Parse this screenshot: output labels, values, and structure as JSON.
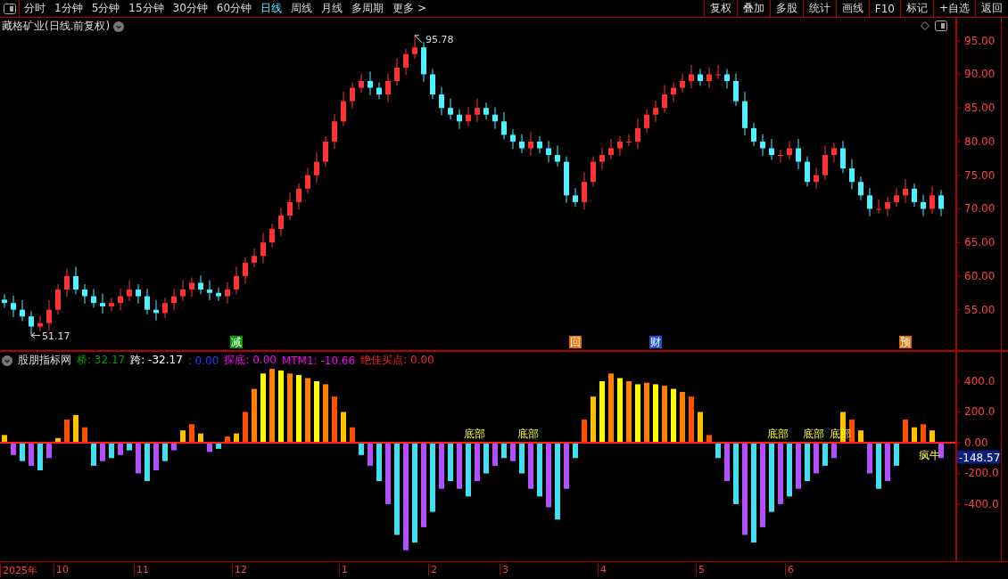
{
  "toolbar": {
    "periods": [
      {
        "label": "分时",
        "selected": false
      },
      {
        "label": "1分钟",
        "selected": false
      },
      {
        "label": "5分钟",
        "selected": false
      },
      {
        "label": "15分钟",
        "selected": false
      },
      {
        "label": "30分钟",
        "selected": false
      },
      {
        "label": "60分钟",
        "selected": false
      },
      {
        "label": "日线",
        "selected": true
      },
      {
        "label": "周线",
        "selected": false
      },
      {
        "label": "月线",
        "selected": false
      },
      {
        "label": "多周期",
        "selected": false
      },
      {
        "label": "更多 >",
        "selected": false
      }
    ],
    "buttons": [
      "复权",
      "叠加",
      "多股",
      "统计",
      "画线",
      "F10",
      "标记",
      "+自选",
      "返回"
    ]
  },
  "price_panel": {
    "title": "藏格矿业(日线.前复权)",
    "chart_data": {
      "type": "candlestick",
      "ylim": [
        49,
        98.4
      ],
      "yticks": [
        {
          "value": 95,
          "label": "95.00"
        },
        {
          "value": 90,
          "label": "90.00"
        },
        {
          "value": 85,
          "label": "85.00"
        },
        {
          "value": 80,
          "label": "80.00"
        },
        {
          "value": 75,
          "label": "75.00"
        },
        {
          "value": 70,
          "label": "70.00"
        },
        {
          "value": 65,
          "label": "65.00"
        },
        {
          "value": 60,
          "label": "60.00"
        },
        {
          "value": 55,
          "label": "55.00"
        }
      ],
      "categories": [
        null,
        null,
        null,
        null,
        null,
        null,
        null,
        null,
        null,
        null,
        null,
        null,
        null,
        null,
        null,
        null,
        null,
        null,
        null,
        null,
        null,
        null,
        null,
        null,
        null,
        null,
        null,
        null,
        null,
        null,
        null,
        null,
        null,
        null,
        null,
        null,
        null,
        null,
        null,
        null,
        null,
        null,
        null,
        null,
        null,
        null,
        null,
        null,
        null,
        null,
        null,
        null,
        null,
        null,
        null,
        null,
        null,
        null,
        null,
        null,
        null,
        null,
        null,
        null,
        null,
        null,
        null,
        null,
        null,
        null,
        null,
        null,
        null,
        null,
        null,
        null,
        null,
        null,
        null,
        null,
        null,
        null,
        null,
        null,
        null,
        null,
        null,
        null,
        null,
        null,
        null,
        null,
        null,
        null,
        null,
        null,
        null,
        null,
        null,
        null,
        null,
        null,
        null,
        null,
        null,
        null
      ],
      "ohlc": [
        [
          56.5,
          57.3,
          55.3,
          56
        ],
        [
          56,
          57.1,
          53.9,
          55
        ],
        [
          55,
          56.4,
          53.3,
          54
        ],
        [
          54,
          54.8,
          51.2,
          52.5
        ],
        [
          52.5,
          54.1,
          51.8,
          53
        ],
        [
          53,
          56.4,
          51.9,
          55
        ],
        [
          55,
          58.8,
          54.3,
          58
        ],
        [
          58,
          61.1,
          56.9,
          60
        ],
        [
          60,
          61.4,
          57.3,
          58
        ],
        [
          58,
          58.8,
          55.9,
          57
        ],
        [
          57,
          58.1,
          55.3,
          56
        ],
        [
          56,
          57.4,
          54.4,
          55.5
        ],
        [
          55.5,
          56.8,
          54.8,
          56
        ],
        [
          56,
          58.1,
          54.9,
          57
        ],
        [
          57,
          59.4,
          56.3,
          58
        ],
        [
          58,
          58.8,
          55.9,
          57
        ],
        [
          57,
          58.1,
          54.3,
          55
        ],
        [
          55,
          56.4,
          53.4,
          54.5
        ],
        [
          54.5,
          56.8,
          53.8,
          56
        ],
        [
          56,
          58.1,
          54.9,
          57
        ],
        [
          57,
          59.4,
          56.3,
          58
        ],
        [
          58,
          59.8,
          56.9,
          59
        ],
        [
          59,
          60.1,
          57.3,
          58
        ],
        [
          58,
          59.4,
          56.4,
          57.5
        ],
        [
          57.5,
          58.3,
          56.3,
          57
        ],
        [
          57,
          59.1,
          55.9,
          58
        ],
        [
          58,
          61.4,
          57.3,
          60
        ],
        [
          60,
          62.8,
          58.9,
          62
        ],
        [
          62,
          64.1,
          61.3,
          63
        ],
        [
          63,
          66.4,
          61.9,
          65
        ],
        [
          65,
          67.8,
          64.3,
          67
        ],
        [
          67,
          70.1,
          65.9,
          69
        ],
        [
          69,
          72.4,
          68.3,
          71
        ],
        [
          71,
          73.8,
          69.9,
          73
        ],
        [
          73,
          76.1,
          72.3,
          75
        ],
        [
          75,
          78.4,
          73.9,
          77
        ],
        [
          77,
          80.8,
          76.3,
          80
        ],
        [
          80,
          84.1,
          78.9,
          83
        ],
        [
          83,
          87.4,
          82.3,
          86
        ],
        [
          86,
          88.8,
          84.9,
          88
        ],
        [
          88,
          90.1,
          87.3,
          89
        ],
        [
          89,
          90.4,
          86.9,
          88
        ],
        [
          88,
          88.8,
          86.3,
          87
        ],
        [
          87,
          90.1,
          85.9,
          89
        ],
        [
          89,
          92.4,
          88.3,
          91
        ],
        [
          91,
          93.8,
          89.9,
          93
        ],
        [
          93,
          95.78,
          92.3,
          94
        ],
        [
          94,
          94.8,
          88.9,
          90
        ],
        [
          90,
          90.8,
          86.3,
          87
        ],
        [
          87,
          88.1,
          83.9,
          85
        ],
        [
          85,
          86.4,
          83.3,
          84
        ],
        [
          84,
          84.8,
          81.9,
          83
        ],
        [
          83,
          85.1,
          82.3,
          84
        ],
        [
          84,
          86.4,
          82.9,
          85
        ],
        [
          85,
          85.8,
          83.3,
          84
        ],
        [
          84,
          85.1,
          81.9,
          83
        ],
        [
          83,
          84.4,
          80.3,
          81
        ],
        [
          81,
          81.8,
          78.9,
          80
        ],
        [
          80,
          81.1,
          78.3,
          79
        ],
        [
          79,
          81.4,
          77.9,
          80
        ],
        [
          80,
          80.8,
          78.3,
          79
        ],
        [
          79,
          80.1,
          76.9,
          78
        ],
        [
          78,
          79.4,
          76.3,
          77
        ],
        [
          77,
          77.8,
          70.9,
          72
        ],
        [
          72,
          73.1,
          70.3,
          71
        ],
        [
          71,
          75.4,
          69.9,
          74
        ],
        [
          74,
          77.8,
          73.3,
          77
        ],
        [
          77,
          79.1,
          75.9,
          78
        ],
        [
          78,
          80.4,
          77.3,
          79
        ],
        [
          79,
          80.8,
          77.9,
          80
        ],
        [
          80,
          81.1,
          79.3,
          80
        ],
        [
          80,
          83.4,
          78.9,
          82
        ],
        [
          82,
          84.8,
          81.3,
          84
        ],
        [
          84,
          86.1,
          82.9,
          85
        ],
        [
          85,
          88.4,
          84.3,
          87
        ],
        [
          87,
          88.8,
          85.9,
          88
        ],
        [
          88,
          90.1,
          87.3,
          89
        ],
        [
          89,
          91.4,
          87.9,
          90
        ],
        [
          90,
          90.8,
          88.3,
          89
        ],
        [
          89,
          91.1,
          87.9,
          90
        ],
        [
          90,
          91.4,
          89.3,
          90
        ],
        [
          90,
          90.8,
          87.9,
          89
        ],
        [
          89,
          90.1,
          85.3,
          86
        ],
        [
          86,
          87.4,
          80.9,
          82
        ],
        [
          82,
          82.8,
          79.3,
          80
        ],
        [
          80,
          81.1,
          77.9,
          79
        ],
        [
          79,
          80.4,
          77.3,
          78
        ],
        [
          78,
          78.8,
          76.9,
          78
        ],
        [
          78,
          80.1,
          77.3,
          79
        ],
        [
          79,
          80.4,
          75.9,
          77
        ],
        [
          77,
          77.8,
          73.3,
          74
        ],
        [
          74,
          76.1,
          72.9,
          75
        ],
        [
          75,
          79.4,
          74.3,
          78
        ],
        [
          78,
          79.8,
          76.9,
          79
        ],
        [
          79,
          80.1,
          75.3,
          76
        ],
        [
          76,
          77.4,
          72.9,
          74
        ],
        [
          74,
          74.8,
          71.3,
          72
        ],
        [
          72,
          73.1,
          68.9,
          70
        ],
        [
          70,
          71.4,
          69.3,
          70
        ],
        [
          70,
          71.8,
          68.9,
          71
        ],
        [
          71,
          73.1,
          70.3,
          72
        ],
        [
          72,
          74.4,
          70.9,
          73
        ],
        [
          73,
          73.8,
          70.3,
          71
        ],
        [
          71,
          72.1,
          68.9,
          70
        ],
        [
          70,
          73.4,
          69.3,
          72
        ],
        [
          72,
          72.8,
          68.9,
          70
        ]
      ]
    },
    "extremes": [
      {
        "kind": "high",
        "text": "95.78"
      },
      {
        "kind": "low",
        "text": "51.17"
      }
    ],
    "markers": [
      {
        "text": "减",
        "color": "#00a000"
      },
      {
        "text": "回",
        "color": "#e07000"
      },
      {
        "text": "财",
        "color": "#2050e0"
      },
      {
        "text": "预",
        "color": "#e07000"
      }
    ]
  },
  "indicator_panel": {
    "title": "股朋指标网",
    "legend": [
      {
        "label": "桥: 32.17",
        "color": "#00a000"
      },
      {
        "label": "跨: -32.17",
        "color": "#ffffff"
      },
      {
        "label": ": 0.00",
        "color": "#2040ff"
      },
      {
        "label": "探底: 0.00",
        "color": "#ff00ff"
      },
      {
        "label": "MTM1: -10.66",
        "color": "#ff00ff"
      },
      {
        "label": "绝佳买点: 0.00",
        "color": "#ff2020"
      }
    ],
    "chart_data": {
      "type": "bar",
      "ylim": [
        -771,
        591
      ],
      "yticks": [
        {
          "value": 400,
          "label": "400.0"
        },
        {
          "value": 200,
          "label": "200.0"
        },
        {
          "value": 0,
          "label": "0.00"
        },
        {
          "value": -200,
          "label": "-200.0"
        },
        {
          "value": -400,
          "label": "-400.0"
        }
      ],
      "categories": [
        null,
        null,
        null,
        null,
        null,
        null,
        null,
        null,
        null,
        null,
        null,
        null,
        null,
        null,
        null,
        null,
        null,
        null,
        null,
        null,
        null,
        null,
        null,
        null,
        null,
        null,
        null,
        null,
        null,
        null,
        null,
        null,
        null,
        null,
        null,
        null,
        null,
        null,
        null,
        null,
        null,
        null,
        null,
        null,
        null,
        null,
        null,
        null,
        null,
        null,
        null,
        null,
        null,
        null,
        null,
        null,
        null,
        null,
        null,
        null,
        null,
        null,
        null,
        null,
        null,
        null,
        null,
        null,
        null,
        null,
        null,
        null,
        null,
        null,
        null,
        null,
        null,
        null,
        null,
        null,
        null,
        null,
        null,
        null,
        null,
        null,
        null,
        null,
        null,
        null,
        null,
        null,
        null,
        null,
        null,
        null,
        null,
        null,
        null,
        null,
        null,
        null,
        null,
        null,
        null,
        null
      ],
      "values": [
        50,
        -80,
        -120,
        -150,
        -180,
        -100,
        30,
        150,
        180,
        100,
        -150,
        -120,
        -100,
        -80,
        -50,
        -200,
        -250,
        -180,
        -120,
        -50,
        80,
        120,
        60,
        -60,
        -40,
        40,
        60,
        200,
        350,
        450,
        480,
        470,
        450,
        440,
        420,
        400,
        380,
        300,
        200,
        100,
        -80,
        -150,
        -250,
        -400,
        -600,
        -700,
        -650,
        -550,
        -450,
        -300,
        -250,
        -300,
        -350,
        -250,
        -200,
        -150,
        -100,
        -120,
        -200,
        -300,
        -350,
        -420,
        -500,
        -300,
        -100,
        150,
        300,
        400,
        450,
        420,
        400,
        380,
        390,
        380,
        370,
        350,
        330,
        300,
        200,
        50,
        -100,
        -250,
        -400,
        -600,
        -650,
        -550,
        -450,
        -400,
        -350,
        -300,
        -250,
        -200,
        -150,
        -100,
        200,
        150,
        80,
        -200,
        -300,
        -250,
        -150,
        150,
        100,
        120,
        80,
        -100
      ]
    },
    "signals": [
      {
        "kind": "above",
        "text": "底部"
      },
      {
        "kind": "above",
        "text": "底部"
      },
      {
        "kind": "above",
        "text": "底部"
      },
      {
        "kind": "above",
        "text": "底部"
      },
      {
        "kind": "above",
        "text": "底部"
      },
      {
        "kind": "below",
        "text": "疯牛"
      }
    ],
    "current_value": "-148.57"
  },
  "time_axis": [
    "2025年",
    "10",
    "11",
    "12",
    "1",
    "2",
    "3",
    "4",
    "5",
    "6"
  ]
}
